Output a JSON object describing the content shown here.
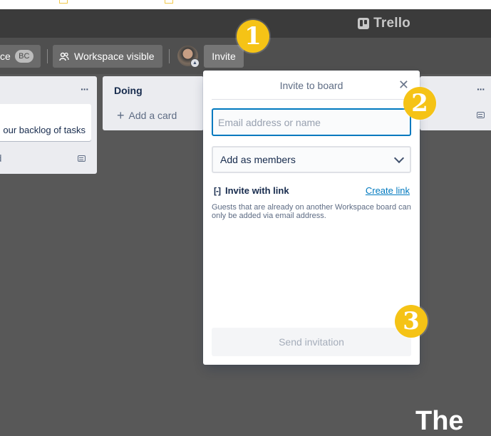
{
  "header": {
    "logo_text": "Trello"
  },
  "board_header": {
    "workspace_suffix": "ce",
    "workspace_badge": "BC",
    "visibility_label": "Workspace visible",
    "invite_label": "Invite"
  },
  "lists": {
    "left": {
      "card_text": "our backlog of tasks",
      "add_card_fragment": "rd",
      "menu": "···"
    },
    "doing": {
      "title": "Doing",
      "add_card_label": "Add a card",
      "menu": "···"
    },
    "right": {
      "menu": "···"
    }
  },
  "invite_popover": {
    "title": "Invite to board",
    "close_glyph": "✕",
    "email_placeholder": "Email address or name",
    "role_select_value": "Add as members",
    "invite_with_link_label": "Invite with link",
    "create_link_label": "Create link",
    "guest_note": "Guests that are already on another Workspace board can only be added via email address.",
    "send_button_label": "Send invitation"
  },
  "callouts": [
    "1",
    "2",
    "3"
  ],
  "bottom_text": "The",
  "colors": {
    "accent_blue": "#0079bf",
    "callout_yellow": "#f5c316"
  }
}
